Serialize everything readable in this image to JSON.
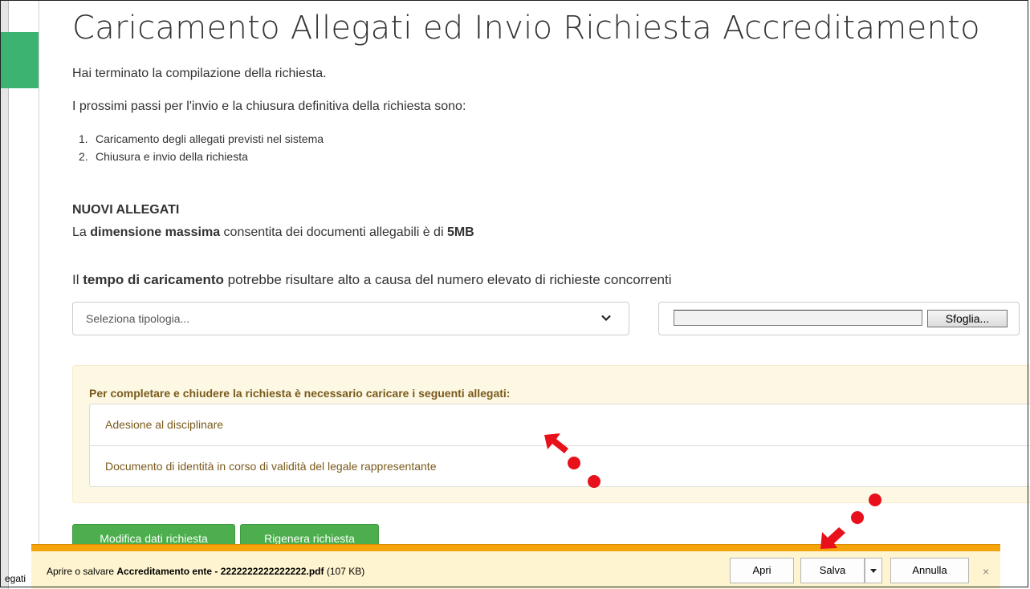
{
  "page": {
    "title": "Caricamento Allegati ed Invio Richiesta Accreditamento",
    "intro": "Hai terminato la compilazione della richiesta.",
    "next_steps_intro": "I prossimi passi per l'invio e la chiusura definitiva della richiesta sono:",
    "steps": [
      {
        "num": "1.",
        "text": "Caricamento degli allegati previsti nel sistema"
      },
      {
        "num": "2.",
        "text": "Chiusura e invio della richiesta"
      }
    ]
  },
  "attachments": {
    "section_title": "NUOVI ALLEGATI",
    "size_prefix": "La ",
    "size_bold": "dimensione massima",
    "size_middle": " consentita dei documenti allegabili è di ",
    "size_value": "5MB",
    "time_prefix": "Il ",
    "time_bold": "tempo di caricamento",
    "time_suffix": " potrebbe risultare alto a causa del numero elevato di richieste concorrenti",
    "select_placeholder": "Seleziona tipologia...",
    "browse_label": "Sfoglia..."
  },
  "required": {
    "title": "Per completare e chiudere la richiesta è necessario caricare i seguenti allegati:",
    "items": [
      "Adesione al disciplinare",
      "Documento di identità in corso di validità del legale rappresentante"
    ]
  },
  "actions": {
    "modify_label": "Modifica dati richiesta",
    "regenerate_label": "Rigenera richiesta",
    "button_color": "#4cae4c"
  },
  "status_bar": {
    "text": "egati"
  },
  "download_bar": {
    "prefix": "Aprire o salvare ",
    "filename": "Accreditamento ente - 2222222222222222.pdf",
    "size": " (107 KB)",
    "open_label": "Apri",
    "save_label": "Salva",
    "cancel_label": "Annulla",
    "close_icon": "×",
    "stripe_color": "#f5a40c"
  },
  "colors": {
    "accent_green": "#3cb371",
    "warning_text": "#7a5a1c",
    "warning_bg": "#fcf8e3",
    "annotation_red": "#e8101a"
  }
}
